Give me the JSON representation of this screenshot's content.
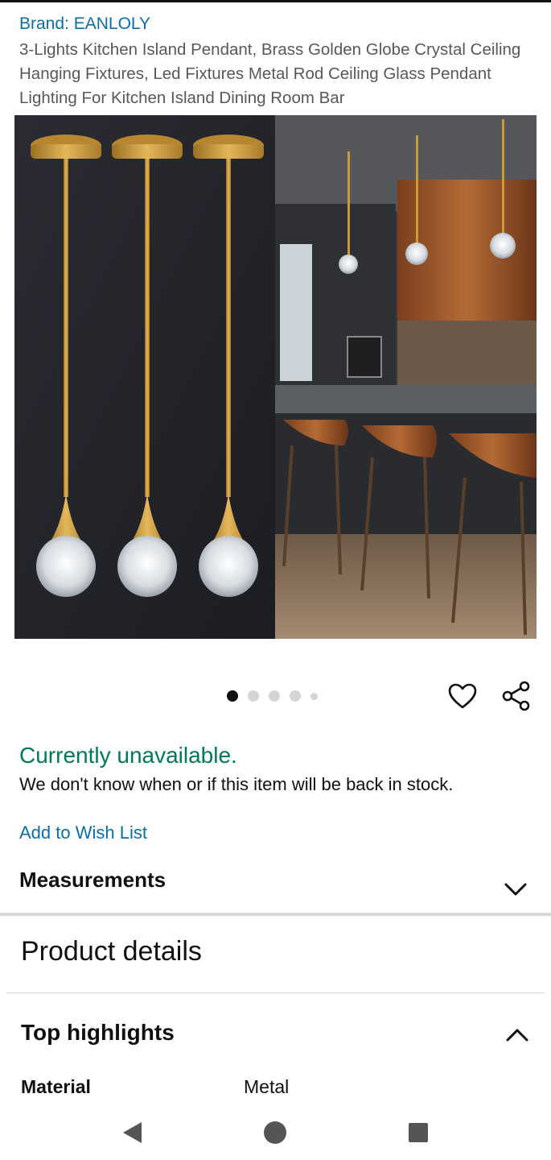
{
  "product": {
    "brand": "Brand: EANLOLY",
    "title": "3-Lights Kitchen Island Pendant, Brass Golden Globe Crystal Ceiling Hanging Fixtures, Led Fixtures Metal Rod Ceiling Glass Pendant Lighting For Kitchen Island Dining Room Bar"
  },
  "gallery": {
    "image_count": 5,
    "active_index": 0
  },
  "actions": {
    "wishlist_icon": "heart-icon",
    "share_icon": "share-icon"
  },
  "availability": {
    "status": "Currently unavailable.",
    "detail": "We don't know when or if this item will be back in stock.",
    "status_color": "#007a5a"
  },
  "wishlist": {
    "label": "Add to Wish List"
  },
  "sections": {
    "measurements": "Measurements",
    "product_details": "Product details",
    "top_highlights": "Top highlights"
  },
  "highlights": [
    {
      "name": "Material",
      "value": "Metal"
    }
  ],
  "colors": {
    "link": "#0a6ea8",
    "brass": "#c89a3a"
  },
  "navbar": {
    "back_icon": "back-triangle-icon",
    "home_icon": "home-circle-icon",
    "recents_icon": "recents-square-icon"
  }
}
